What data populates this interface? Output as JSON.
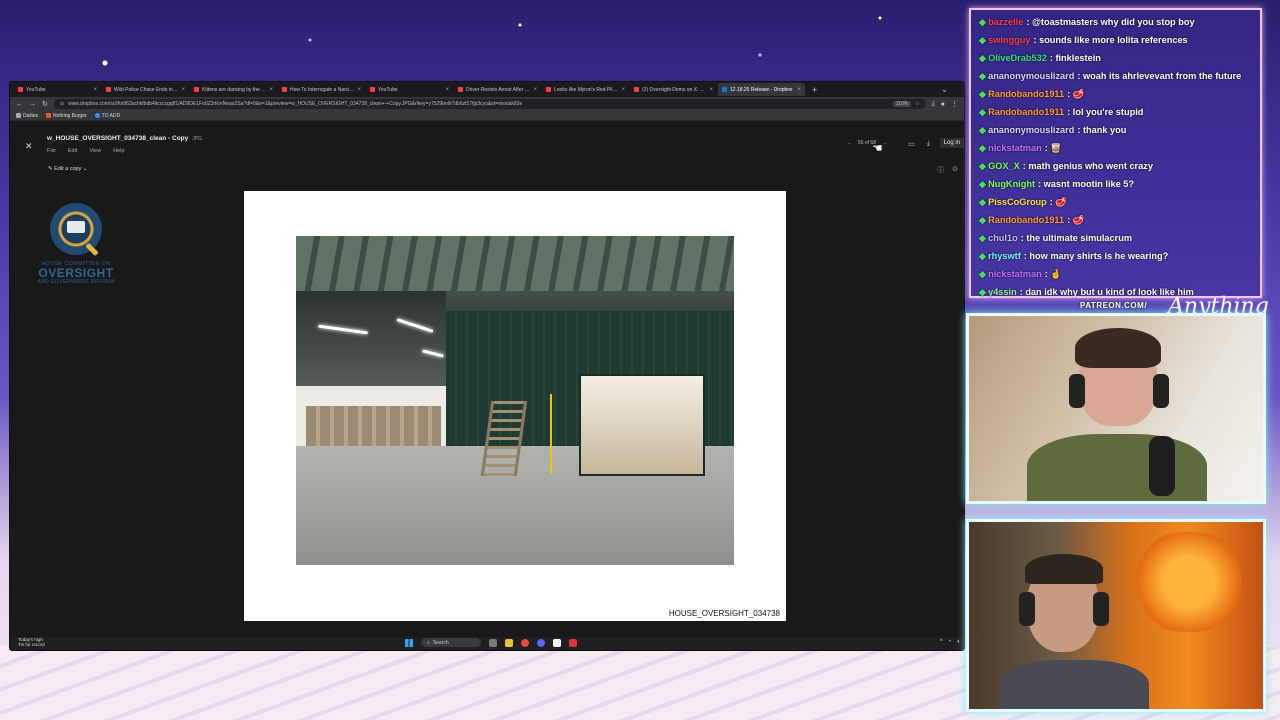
{
  "browser": {
    "tabs": [
      {
        "label": "YouTube",
        "active": false
      },
      {
        "label": "Wild Police Chase Ends in Crash",
        "active": false
      },
      {
        "label": "Kittens are dancing by the track",
        "active": false
      },
      {
        "label": "How To Interrogate a Narcissist",
        "active": false
      },
      {
        "label": "YouTube",
        "active": false
      },
      {
        "label": "Driver Resists Arrest After Refusing",
        "active": false
      },
      {
        "label": "Looks like Myron's Red Pill video",
        "active": false
      },
      {
        "label": "(2) Oversight Dems on X: \"NEW",
        "active": false
      },
      {
        "label": "12.18.25 Release - Dropbox",
        "active": true
      }
    ],
    "url": "www.dropbox.com/scl/fo/d63uchkfbdb4ilczczgq81/AD9DE1Fo0Z2rKmNeao2Sa?dl=0&e=1&preview=w_HOUSE_OVERSIGHT_034738_clean+-+Copy.JPG&rlkey=y7529bn9i7db6zf27fjp3cyu&st=msnlak82e",
    "zoom": "110%",
    "bookmarks": [
      "Dailies",
      "Nothing Burger",
      "TO ADD"
    ]
  },
  "viewer": {
    "file_name": "w_HOUSE_OVERSIGHT_034738_clean - Copy",
    "file_ext": "JPG",
    "menu": [
      "File",
      "Edit",
      "View",
      "Help"
    ],
    "edit_copy_label": "Edit a copy",
    "pager": "56 of 68",
    "login_label": "Log in",
    "doc_caption": "HOUSE_OVERSIGHT_034738"
  },
  "logo": {
    "line1": "HOUSE COMMITTEE ON",
    "line2": "OVERSIGHT",
    "line3": "AND GOVERNMENT REFORM",
    "seal_text": "OVERSIGHT · TRANSPARENCY · ACCOUNTABILITY"
  },
  "taskbar": {
    "weather_title": "Today's high",
    "weather_sub": "Tie for record",
    "search_label": "Search"
  },
  "chat": [
    {
      "user": "bazzelle",
      "color": "#ff3d5a",
      "msg": "@toastmasters why did you stop boy"
    },
    {
      "user": "swingguy",
      "color": "#ff3d5a",
      "msg": "sounds like more lolita references"
    },
    {
      "user": "OliveDrab532",
      "color": "#2ee08a",
      "msg": "finklestein"
    },
    {
      "user": "ananonymouslizard",
      "color": "#d8d8ff",
      "msg": "woah its ahrlevevant from the future"
    },
    {
      "user": "Randobando1911",
      "color": "#ff9a3c",
      "msg": "🥩"
    },
    {
      "user": "Randobando1911",
      "color": "#ff9a3c",
      "msg": "lol you're stupid"
    },
    {
      "user": "ananonymouslizard",
      "color": "#d8d8ff",
      "msg": "thank you"
    },
    {
      "user": "nickstatman",
      "color": "#c070ff",
      "msg": "🥃"
    },
    {
      "user": "GOX_X",
      "color": "#7cff5a",
      "msg": "math genius who went crazy"
    },
    {
      "user": "NugKnight",
      "color": "#7cff5a",
      "msg": "wasnt mootin like 5?"
    },
    {
      "user": "PissCoGroup",
      "color": "#ffe04a",
      "msg": "🥩"
    },
    {
      "user": "Randobando1911",
      "color": "#ff9a3c",
      "msg": "🥩"
    },
    {
      "user": "chul1o",
      "color": "#c8b8ff",
      "msg": "the ultimate simulacrum"
    },
    {
      "user": "rhyswtf",
      "color": "#7cf0ff",
      "msg": "how many shirts is he wearing?"
    },
    {
      "user": "nickstatman",
      "color": "#c070ff",
      "msg": "🤞"
    },
    {
      "user": "y4ssin",
      "color": "#9bf09b",
      "msg": "dan idk why but u kind of look like him"
    }
  ],
  "overlay": {
    "patreon": "PATREON.COM/",
    "signature": "Anything"
  }
}
